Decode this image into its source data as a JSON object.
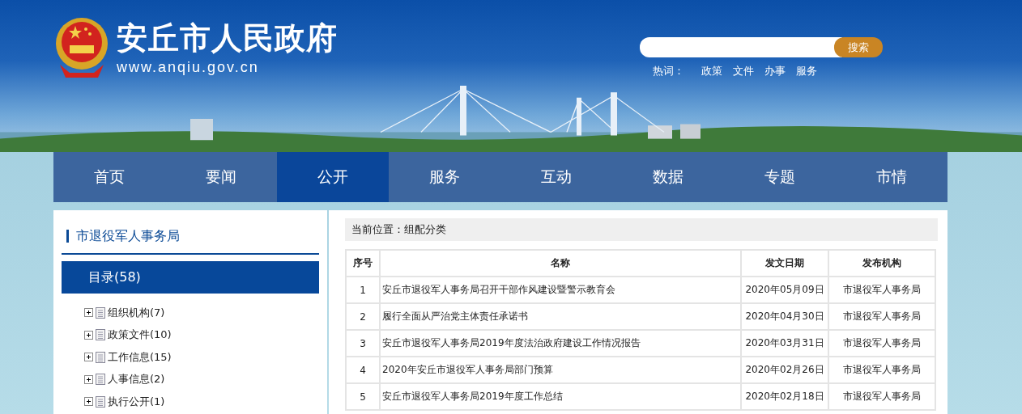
{
  "header": {
    "site_title": "安丘市人民政府",
    "site_url": "www.anqiu.gov.cn",
    "search": {
      "button": "搜索"
    },
    "hot_words": {
      "label": "热词：",
      "items": [
        "政策",
        "文件",
        "办事",
        "服务"
      ]
    }
  },
  "nav": [
    {
      "label": "首页",
      "selected": false
    },
    {
      "label": "要闻",
      "selected": false
    },
    {
      "label": "公开",
      "selected": true
    },
    {
      "label": "服务",
      "selected": false
    },
    {
      "label": "互动",
      "selected": false
    },
    {
      "label": "数据",
      "selected": false
    },
    {
      "label": "专题",
      "selected": false
    },
    {
      "label": "市情",
      "selected": false
    }
  ],
  "sidebar": {
    "title": "市退役军人事务局",
    "catalog": "目录(58)",
    "items": [
      {
        "label": "组织机构(7)",
        "expanded": false
      },
      {
        "label": "政策文件(10)",
        "expanded": false
      },
      {
        "label": "工作信息(15)",
        "expanded": false
      },
      {
        "label": "人事信息(2)",
        "expanded": false
      },
      {
        "label": "执行公开(1)",
        "expanded": false
      }
    ]
  },
  "breadcrumb": "当前位置：组配分类",
  "table": {
    "columns": [
      "序号",
      "名称",
      "发文日期",
      "发布机构"
    ],
    "rows": [
      [
        "1",
        "安丘市退役军人事务局召开干部作风建设暨警示教育会",
        "2020年05月09日",
        "市退役军人事务局"
      ],
      [
        "2",
        "履行全面从严治党主体责任承诺书",
        "2020年04月30日",
        "市退役军人事务局"
      ],
      [
        "3",
        "安丘市退役军人事务局2019年度法治政府建设工作情况报告",
        "2020年03月31日",
        "市退役军人事务局"
      ],
      [
        "4",
        "2020年安丘市退役军人事务局部门预算",
        "2020年02月26日",
        "市退役军人事务局"
      ],
      [
        "5",
        "安丘市退役军人事务局2019年度工作总结",
        "2020年02月18日",
        "市退役军人事务局"
      ]
    ]
  }
}
